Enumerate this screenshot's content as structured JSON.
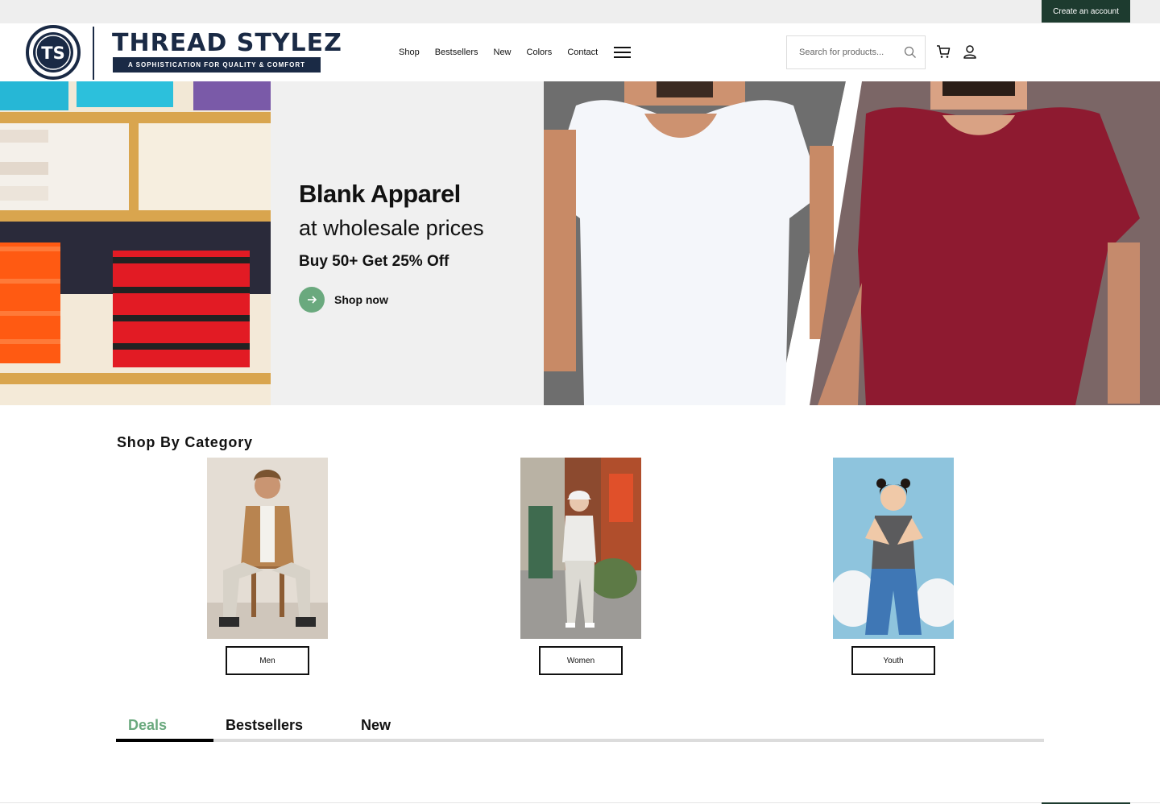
{
  "topbar": {
    "create_account_label": "Create an account"
  },
  "brand": {
    "monogram": "TS",
    "name": "THREAD STYLEZ",
    "tagline": "A SOPHISTICATION FOR QUALITY & COMFORT"
  },
  "nav": {
    "items": [
      "Shop",
      "Bestsellers",
      "New",
      "Colors",
      "Contact"
    ]
  },
  "search": {
    "placeholder": "Search for products..."
  },
  "icons": {
    "search": "search-icon",
    "cart": "cart-icon",
    "user": "user-icon",
    "menu": "hamburger-icon",
    "arrow": "arrow-right-icon"
  },
  "hero": {
    "title": "Blank Apparel",
    "subtitle": "at wholesale prices",
    "offer": "Buy 50+ Get 25% Off",
    "cta_label": "Shop now"
  },
  "categories": {
    "heading": "Shop By Category",
    "items": [
      {
        "label": "Men"
      },
      {
        "label": "Women"
      },
      {
        "label": "Youth"
      }
    ]
  },
  "tabs": {
    "items": [
      "Deals",
      "Bestsellers",
      "New"
    ],
    "active": "Deals"
  },
  "colors": {
    "accent_green": "#6aa97e",
    "dark_green": "#1d3b2f",
    "navy": "#1a2a45",
    "maroon": "#8e1a30"
  }
}
